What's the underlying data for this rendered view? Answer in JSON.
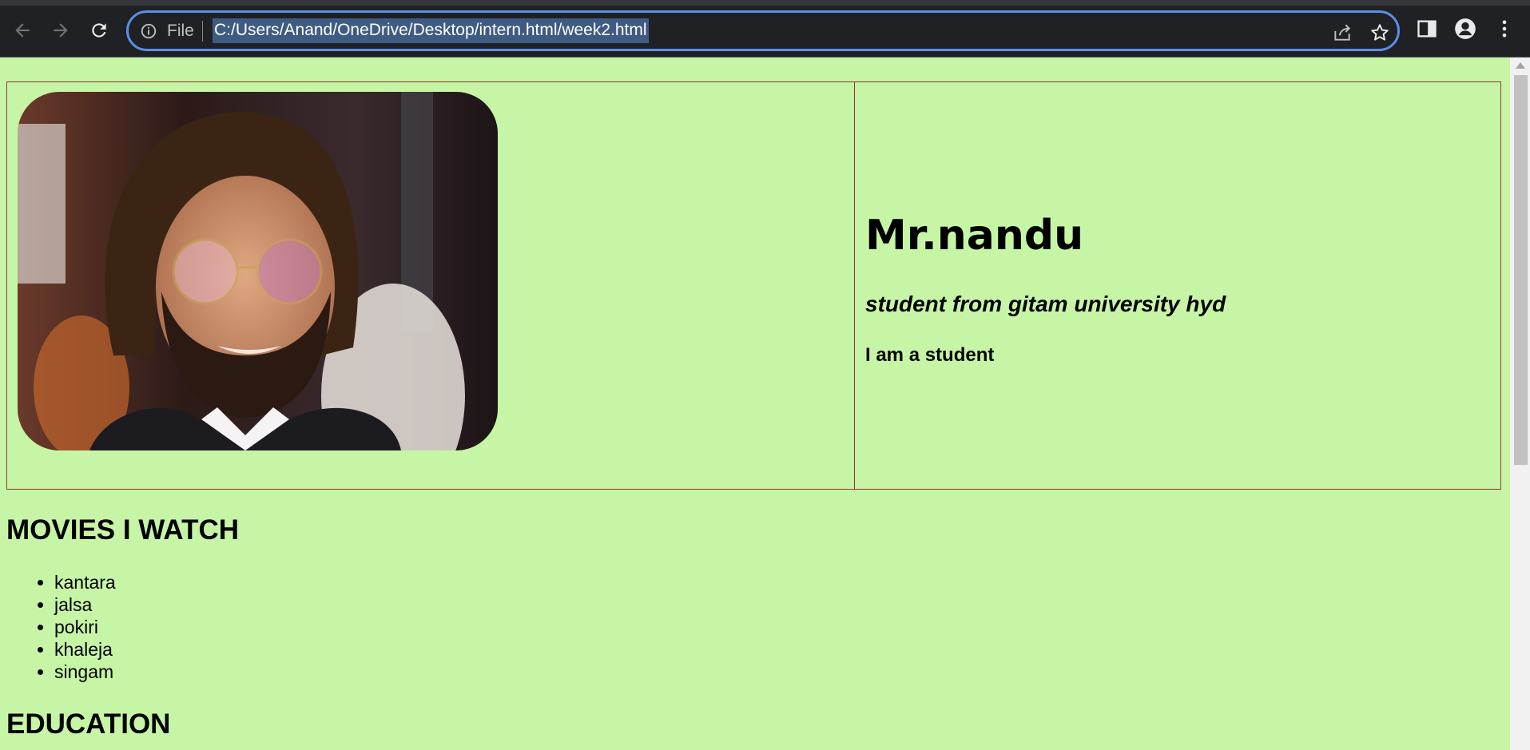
{
  "browser": {
    "file_label": "File",
    "url": "C:/Users/Anand/OneDrive/Desktop/intern.html/week2.html"
  },
  "profile": {
    "name": "Mr.nandu",
    "tagline": "student from gitam university hyd",
    "bio": "I am a student"
  },
  "movies": {
    "heading": "MOVIES I WATCH",
    "items": [
      "kantara",
      "jalsa",
      "pokiri",
      "khaleja",
      "singam"
    ]
  },
  "education": {
    "heading": "EDUCATION"
  },
  "colors": {
    "page_background": "#c7f5a6",
    "table_border": "#8b3a2b",
    "toolbar": "#202124",
    "omnibox_focus": "#5b8fe8"
  }
}
